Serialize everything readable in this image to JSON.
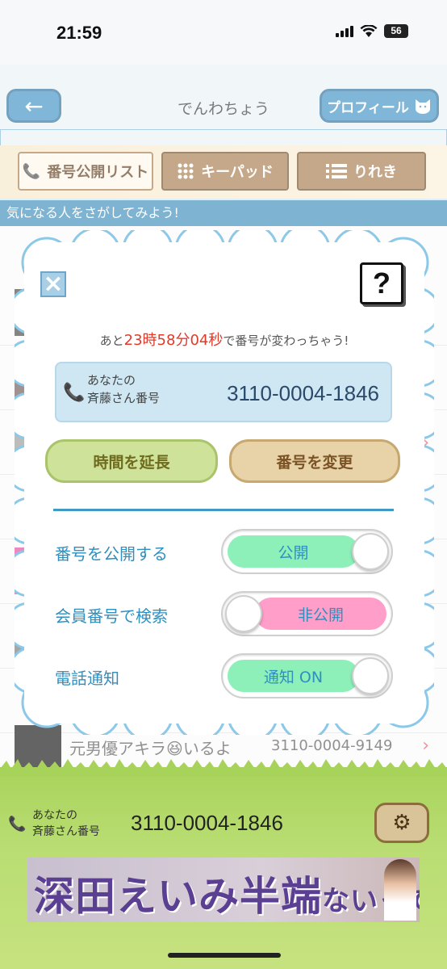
{
  "status_bar": {
    "time": "21:59",
    "battery": "56"
  },
  "header": {
    "back_icon": "←",
    "title": "でんわちょう",
    "profile_label": "プロフィール",
    "profile_icon": "cat-icon"
  },
  "tabs": [
    {
      "label": "番号公開リスト",
      "icon": "phone-icon"
    },
    {
      "label": "キーパッド",
      "icon": "keypad-icon"
    },
    {
      "label": "りれき",
      "icon": "list-icon"
    }
  ],
  "banner": "気になる人をさがしてみよう!",
  "list_partial": {
    "name": "元男優アキラ😆いるよ",
    "number": "3110-0004-9149"
  },
  "modal": {
    "countdown": {
      "prefix": "あと",
      "hours": "23",
      "h_unit": "時",
      "minutes": "58",
      "m_unit": "分",
      "seconds": "04",
      "s_unit": "秒",
      "suffix": "で番号が変わっちゃう!"
    },
    "number_label_line1": "あなたの",
    "number_label_line2": "斉藤さん番号",
    "number_value": "3110-0004-1846",
    "extend_button": "時間を延長",
    "change_button": "番号を変更",
    "settings": [
      {
        "label": "番号を公開する",
        "toggle_text": "公開",
        "state": "on"
      },
      {
        "label": "会員番号で検索",
        "toggle_text": "非公開",
        "state": "off"
      },
      {
        "label": "電話通知",
        "toggle_text": "通知 ON",
        "state": "on"
      }
    ]
  },
  "footer": {
    "label_line1": "あなたの",
    "label_line2": "斉藤さん番号",
    "number": "3110-0004-1846",
    "ad_text_main": "深田えいみ半端",
    "ad_text_small": "ないって"
  },
  "colors": {
    "accent_blue": "#3f9ac8",
    "countdown_red": "#e03a2a",
    "toggle_on": "#8df0b8",
    "toggle_off": "#ff9ec9"
  }
}
